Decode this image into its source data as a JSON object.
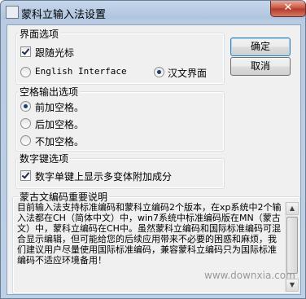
{
  "window": {
    "title": "蒙科立输入法设置",
    "close_glyph": "✕"
  },
  "group_ui": {
    "label": "界面选项",
    "follow_cursor": {
      "label": "跟随光标",
      "checked": true
    },
    "options": [
      {
        "label": "English Interface",
        "checked": false
      },
      {
        "label": "汉文界面",
        "checked": true
      }
    ]
  },
  "group_space": {
    "label": "空格输出选项",
    "options": [
      {
        "label": "前加空格。",
        "checked": true
      },
      {
        "label": "后加空格。",
        "checked": false
      },
      {
        "label": "不加空格。",
        "checked": false
      }
    ]
  },
  "group_digit": {
    "label": "数字键选项",
    "option": {
      "label": "数字单键上显示多变体附加成分",
      "checked": true
    }
  },
  "info": {
    "label": "蒙古文编码重要说明",
    "text": "目前输入法支持标准编码和蒙科立编码2个版本，在xp系统中2个输入法都在CH（简体中文）中，win7系统中标准编码版在MN（蒙古文）中，蒙科立编码在CH中。虽然蒙科立编码和国际标准编码可混合显示编辑，但可能给您的后续应用带来不必要的困惑和麻烦，我们建议用户尽量使用国际标准编码，兼容蒙科立编码只为国际标准编码不适应环境备用！"
  },
  "buttons": {
    "ok": "确定",
    "cancel": "取消"
  },
  "watermark": "www.downxia.com"
}
